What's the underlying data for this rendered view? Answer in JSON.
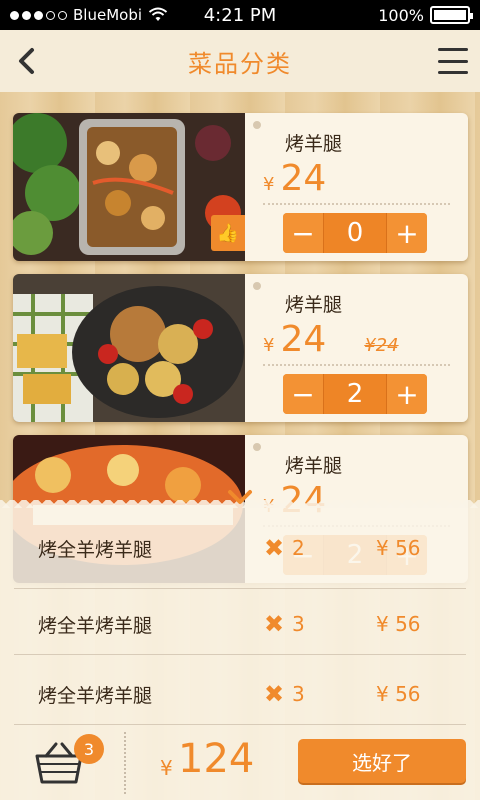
{
  "status_bar": {
    "carrier": "BlueMobi",
    "time": "4:21 PM",
    "battery": "100%"
  },
  "header": {
    "title": "菜品分类"
  },
  "dishes": [
    {
      "name": "烤羊腿",
      "yen": "¥",
      "price": "24",
      "old_price": "",
      "qty": "0",
      "minus": "−",
      "plus": "+"
    },
    {
      "name": "烤羊腿",
      "yen": "¥",
      "price": "24",
      "old_price": "¥24",
      "qty": "2",
      "minus": "−",
      "plus": "+"
    },
    {
      "name": "烤羊腿",
      "yen": "¥",
      "price": "24",
      "old_price": "",
      "qty": "2",
      "minus": "−",
      "plus": "+"
    }
  ],
  "cart": {
    "items": [
      {
        "name": "烤全羊烤羊腿",
        "qty": "2",
        "price": "¥ 56"
      },
      {
        "name": "烤全羊烤羊腿",
        "qty": "3",
        "price": "¥ 56"
      },
      {
        "name": "烤全羊烤羊腿",
        "qty": "3",
        "price": "¥ 56"
      }
    ],
    "badge_count": "3",
    "total_yen": "¥",
    "total": "124",
    "confirm_label": "选好了"
  },
  "colors": {
    "accent": "#f08a2c",
    "wood": "#e9d2a8"
  }
}
